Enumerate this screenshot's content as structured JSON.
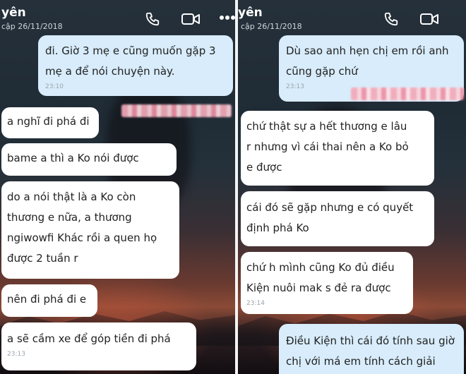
{
  "left": {
    "header": {
      "name": "yên",
      "subtitle": "cập 26/11/2018"
    },
    "messages": [
      {
        "text": "đi. Giờ 3 mẹ e cũng muốn gặp 3\nmẹ a để nói chuyện này.",
        "time": "23:10"
      },
      {
        "text": "a nghĩ đi phá đi"
      },
      {
        "text": "bame a thì a Ko nói được"
      },
      {
        "text": "do a nói thật là a Ko còn\nthương e nữa, a thương\nngiwowfi Khác rồi a quen họ\nđược 2 tuần r"
      },
      {
        "text": "nên đi phá đi e"
      },
      {
        "text": "a sẽ cầm xe để góp tiền đi phá",
        "time": "23:13"
      }
    ]
  },
  "right": {
    "header": {
      "name": "yên",
      "subtitle": "cập 26/11/2018"
    },
    "messages": [
      {
        "text": "Dù sao anh hẹn chị em rồi anh\ncũng gặp chứ",
        "time": "23:13"
      },
      {
        "text": "chứ thật sự a hết thương e lâu\nr nhưng vì cái thai nên a Ko bỏ\ne được"
      },
      {
        "text": "cái đó sẽ gặp nhưng e có quyết\nđịnh phá Ko"
      },
      {
        "text": "chứ h mình cũng Ko đủ điều\nKiện nuôi mak s đẻ ra được",
        "time": "23:14"
      },
      {
        "text": "Điều Kiện thì cái đó tính sau giờ\nchị với má em tính cách giải"
      }
    ]
  },
  "icons": {
    "call": "phone-icon",
    "video": "video-camera-icon",
    "more": "more-dots-icon"
  },
  "colors": {
    "incoming_bubble": "#ffffff",
    "outgoing_bubble": "#d8ecfb",
    "header_text": "#ffffff",
    "censor": "#f3a9b8"
  }
}
